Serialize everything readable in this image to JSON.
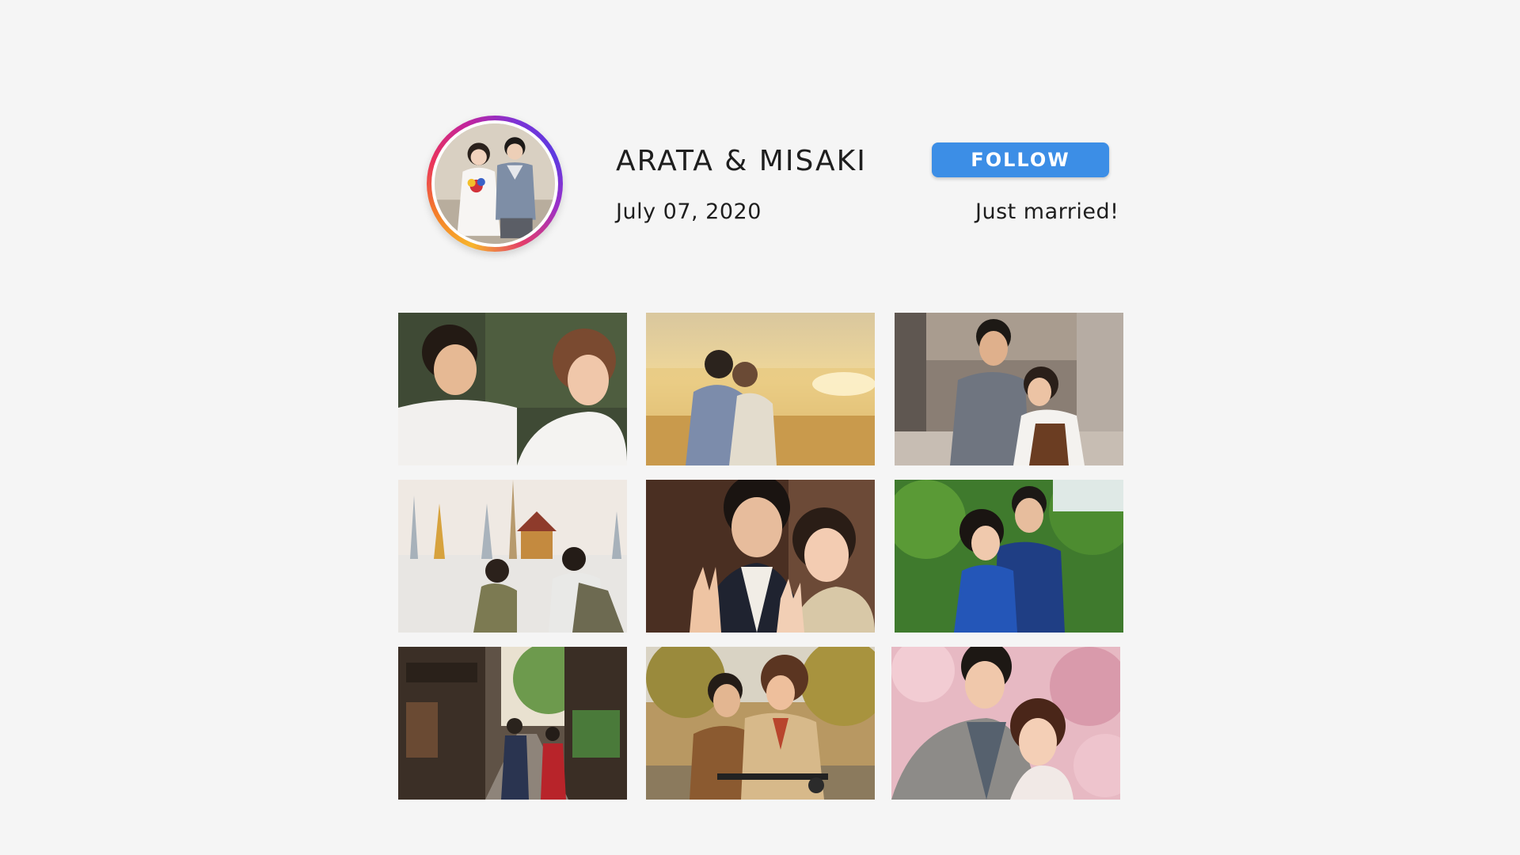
{
  "profile": {
    "name": "ARATA & MISAKI",
    "date": "July 07, 2020",
    "status": "Just married!",
    "follow_label": "FOLLOW"
  },
  "colors": {
    "follow_button": "#3c8ee6",
    "background": "#f5f5f5",
    "text": "#1e1e1e"
  },
  "photos": [
    {
      "subject": "couple smiling outdoors"
    },
    {
      "subject": "couple embracing on beach at sunset"
    },
    {
      "subject": "couple in shopping street"
    },
    {
      "subject": "couple in front of temple"
    },
    {
      "subject": "couple making peace signs"
    },
    {
      "subject": "couple hugging in park"
    },
    {
      "subject": "couple walking in old town street"
    },
    {
      "subject": "couple on scooter in autumn"
    },
    {
      "subject": "couple under cherry blossoms"
    }
  ]
}
